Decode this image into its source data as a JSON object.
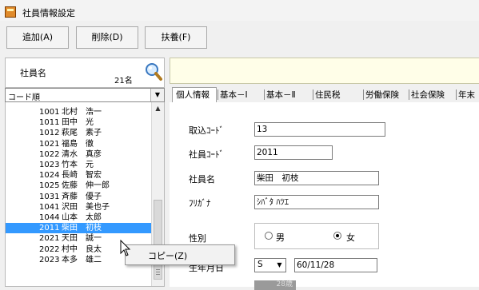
{
  "window": {
    "title": "社員情報設定"
  },
  "toolbar": {
    "add_label": "追加(A)",
    "delete_label": "削除(D)",
    "support_label": "扶養(F)"
  },
  "left_panel": {
    "header_label": "社員名",
    "count": "21名",
    "sort_value": "コード順",
    "employees": [
      {
        "code": "1001",
        "name": "北村　浩一"
      },
      {
        "code": "1011",
        "name": "田中　光"
      },
      {
        "code": "1012",
        "name": "萩尾　素子"
      },
      {
        "code": "1021",
        "name": "福島　徹"
      },
      {
        "code": "1022",
        "name": "清水　真彦"
      },
      {
        "code": "1023",
        "name": "竹本　元"
      },
      {
        "code": "1024",
        "name": "長崎　智宏"
      },
      {
        "code": "1025",
        "name": "佐藤　伸一郎"
      },
      {
        "code": "1031",
        "name": "斉藤　優子"
      },
      {
        "code": "1041",
        "name": "沢田　美也子"
      },
      {
        "code": "1044",
        "name": "山本　太郎"
      },
      {
        "code": "2011",
        "name": "柴田　初枝",
        "selected": true
      },
      {
        "code": "2021",
        "name": "天田　誠一"
      },
      {
        "code": "2022",
        "name": "村中　良太"
      },
      {
        "code": "2023",
        "name": "本多　雄二"
      }
    ]
  },
  "tabs": [
    {
      "label": "個人情報",
      "active": true
    },
    {
      "label": "基本－Ⅰ"
    },
    {
      "label": "基本－Ⅱ"
    },
    {
      "label": "住民税"
    },
    {
      "label": "労働保険"
    },
    {
      "label": "社会保険"
    },
    {
      "label": "年末"
    }
  ],
  "form": {
    "torikomi_code_label": "取込ｺｰﾄﾞ",
    "torikomi_code": "13",
    "employee_code_label": "社員ｺｰﾄﾞ",
    "employee_code": "2011",
    "employee_name_label": "社員名",
    "employee_name": "柴田　初枝",
    "furigana_label": "ﾌﾘｶﾞﾅ",
    "furigana": "ｼﾊﾞﾀ ﾊﾂｴ",
    "gender_label": "性別",
    "gender_male": "男",
    "gender_female": "女",
    "gender_selected": "女",
    "birthdate_label": "生年月日",
    "era": "S",
    "birthdate": "60/11/28",
    "age_partial": "28歳"
  },
  "context_menu": {
    "copy_label": "コピー(Z)"
  },
  "colors": {
    "selection": "#3399ff",
    "header_bg": "#fffee8",
    "app_icon": "#e08a2a"
  }
}
